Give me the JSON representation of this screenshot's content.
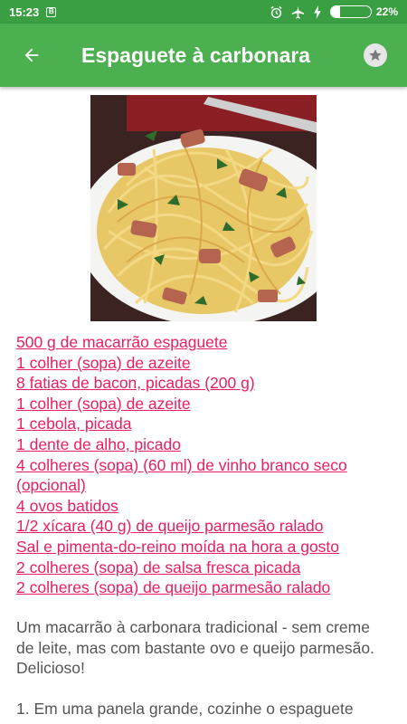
{
  "status_bar": {
    "time": "15:23",
    "app_icon": "B",
    "battery_percent": "22%",
    "battery_level": 0.22
  },
  "app_bar": {
    "title": "Espaguete à carbonara",
    "back_icon": "arrow-back-icon",
    "favorite_icon": "star-icon"
  },
  "recipe": {
    "ingredients": [
      "500 g de macarrão espaguete",
      "1 colher (sopa) de azeite",
      "8 fatias de bacon, picadas (200 g)",
      "1 colher (sopa) de azeite",
      "1 cebola, picada",
      "1 dente de alho, picado",
      "4 colheres (sopa) (60 ml) de vinho branco seco (opcional)",
      "4 ovos batidos",
      "1/2 xícara (40 g) de queijo parmesão ralado",
      "Sal e pimenta-do-reino moída na hora a gosto",
      "2 colheres (sopa) de salsa fresca picada",
      "2 colheres (sopa) de queijo parmesão ralado"
    ],
    "description": "Um macarrão à carbonara tradicional - sem creme de leite, mas com bastante ovo e queijo parmesão. Delicioso!",
    "step_1": "1. Em uma panela grande, cozinhe o espaguete"
  },
  "colors": {
    "status_bar": "#3a9e43",
    "app_bar": "#4caf50",
    "link": "#e91e63",
    "body_text": "#555555"
  }
}
